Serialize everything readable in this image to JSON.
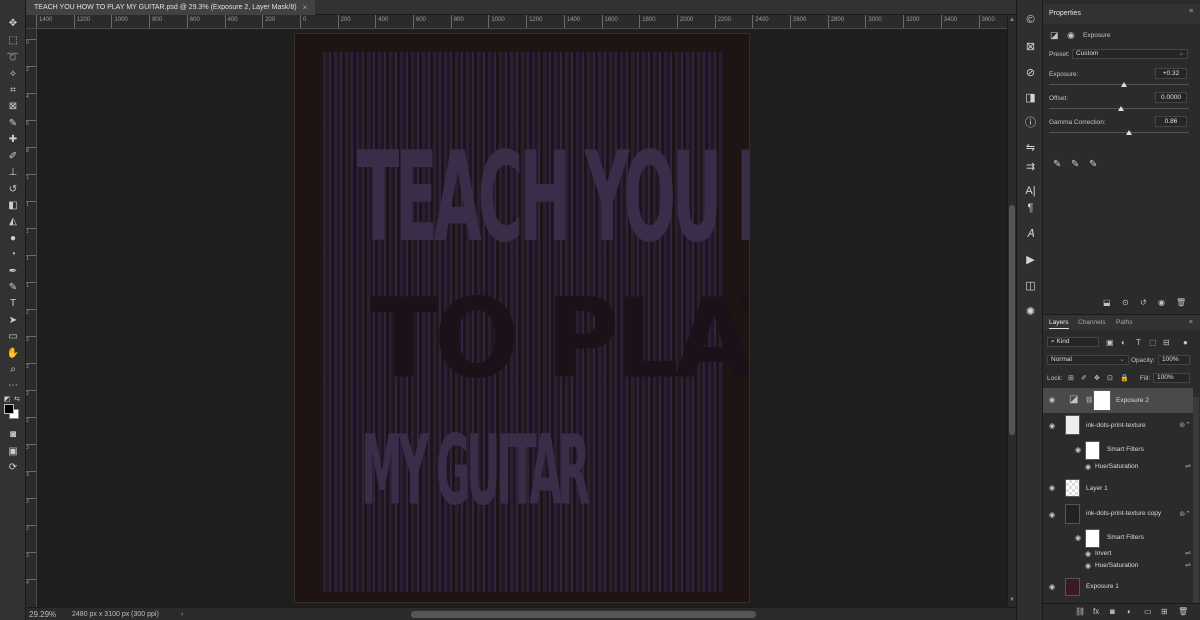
{
  "document": {
    "tab_title": "TEACH YOU HOW TO PLAY MY GUITAR.psd @ 29.3% (Exposure 2, Layer Mask/8)",
    "close_glyph": "×"
  },
  "ruler": {
    "h_ticks": [
      "1400",
      "1200",
      "1000",
      "800",
      "600",
      "400",
      "200",
      "0",
      "200",
      "400",
      "600",
      "800",
      "1000",
      "1200",
      "1400",
      "1600",
      "1800",
      "2000",
      "2200",
      "2400",
      "2600",
      "2800",
      "3000",
      "3200",
      "3400",
      "3600",
      "3800"
    ],
    "v_ticks": [
      "0",
      "2",
      "4",
      "6",
      "8",
      "1",
      "1",
      "1",
      "1",
      "1",
      "2",
      "2",
      "2",
      "2",
      "2",
      "3",
      "3",
      "3",
      "3",
      "3",
      "4"
    ]
  },
  "artwork": {
    "line1": "TEACH YOU HOW",
    "line2": "TO PLAY",
    "line3": "MY GUITAR"
  },
  "status": {
    "zoom": "29.29%",
    "doc_info": "2480 px x 3100 px (300 ppi)",
    "arrow": "›"
  },
  "properties": {
    "tab": "Properties",
    "adjustment": "Exposure",
    "preset_label": "Preset:",
    "preset_value": "Custom",
    "exposure_label": "Exposure:",
    "exposure_value": "+0.32",
    "offset_label": "Offset:",
    "offset_value": "0.0000",
    "gamma_label": "Gamma Correction:",
    "gamma_value": "0.86"
  },
  "layers_panel": {
    "tabs": [
      "Layers",
      "Channels",
      "Paths"
    ],
    "filter_kind": "Kind",
    "blend_mode": "Normal",
    "opacity_label": "Opacity:",
    "opacity_value": "100%",
    "lock_label": "Lock:",
    "fill_label": "Fill:",
    "fill_value": "100%",
    "layers": [
      {
        "name": "Exposure 2"
      },
      {
        "name": "ink-dots-print-texture"
      },
      {
        "name": "Smart Filters"
      },
      {
        "name": "Hue/Saturation"
      },
      {
        "name": "Layer 1"
      },
      {
        "name": "ink-dots-print-texture copy"
      },
      {
        "name": "Smart Filters"
      },
      {
        "name": "Invert"
      },
      {
        "name": "Hue/Saturation"
      },
      {
        "name": "Exposure 1"
      }
    ]
  },
  "colors": {
    "panel_bg": "#2b2b2b",
    "canvas_bg": "#1e1e1e",
    "artboard": "#1f1414",
    "text_purple": "#3a2d4a"
  }
}
